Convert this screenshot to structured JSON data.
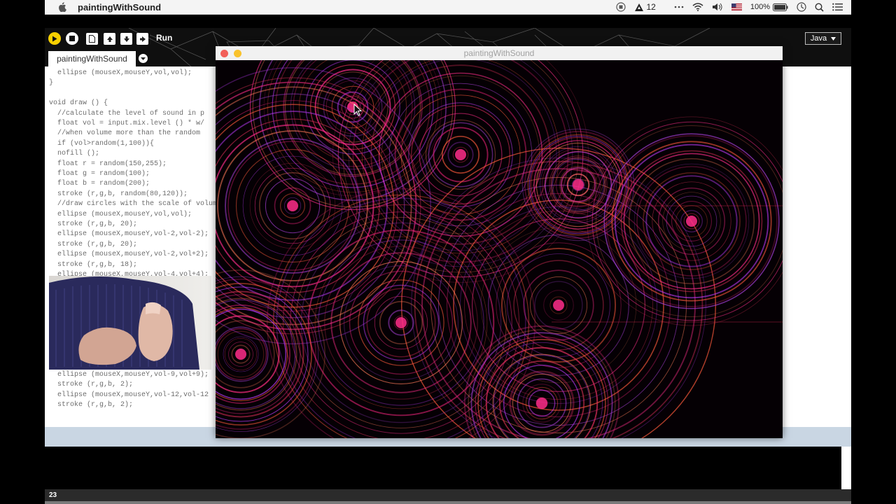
{
  "menubar": {
    "app_name": "paintingWithSound",
    "notification_count": "12",
    "battery": "100%"
  },
  "toolbar": {
    "run_label": "Run",
    "mode": "Java"
  },
  "editor": {
    "tab_name": "paintingWithSound",
    "code_lines": [
      "  ellipse (mouseX,mouseY,vol,vol);",
      "}",
      "",
      "void draw () {",
      "  //calculate the level of sound in p",
      "  float vol = input.mix.level () * w/",
      "  //when volume more than the random",
      "  if (vol>random(1,100)){",
      "  nofill ();",
      "  float r = random(150,255);",
      "  float g = random(100);",
      "  float b = random(200);",
      "  stroke (r,g,b, random(80,120));",
      "  //draw circles with the scale of volum",
      "  ellipse (mouseX,mouseY,vol,vol);",
      "  stroke (r,g,b, 20);",
      "  ellipse (mouseX,mouseY,vol-2,vol-2);",
      "  stroke (r,g,b, 20);",
      "  ellipse (mouseX,mouseY,vol-2,vol+2);",
      "  stroke (r,g,b, 18);",
      "  ellipse (mouseX,mouseY,vol-4,vol+4);"
    ],
    "code_lines_bottom": [
      "  ellipse (mouseX,mouseY,vol-9,vol+9);",
      "  stroke (r,g,b, 2);",
      "  ellipse (mouseX,mouseY,vol-12,vol-12",
      "  stroke (r,g,b, 2);"
    ]
  },
  "sketch": {
    "title": "paintingWithSound"
  },
  "status": {
    "line_number": "23"
  },
  "colors": {
    "accent_pink": "#ff2d8a",
    "canvas_bg": "#050004",
    "run_yellow": "#f7d000"
  }
}
